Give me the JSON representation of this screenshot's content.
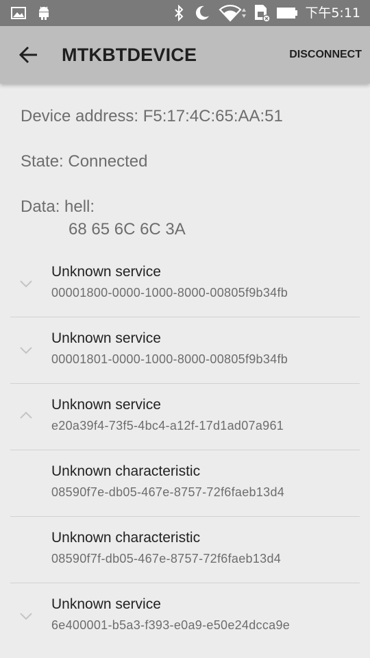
{
  "status_bar": {
    "time": "下午5:11",
    "icons": [
      "image-icon",
      "android-icon",
      "bluetooth-icon",
      "moon-icon",
      "wifi-icon",
      "sim-icon",
      "battery-icon"
    ]
  },
  "app_bar": {
    "title": "MTKBTDEVICE",
    "action": "DISCONNECT"
  },
  "device": {
    "address": "Device address: F5:17:4C:65:AA:51",
    "state": "State: Connected",
    "data_label": "Data: hell:",
    "data_hex": "68 65 6C 6C 3A"
  },
  "items": [
    {
      "title": "Unknown service",
      "uuid": "00001800-0000-1000-8000-00805f9b34fb",
      "chevron": "down"
    },
    {
      "title": "Unknown service",
      "uuid": "00001801-0000-1000-8000-00805f9b34fb",
      "chevron": "down"
    },
    {
      "title": "Unknown service",
      "uuid": "e20a39f4-73f5-4bc4-a12f-17d1ad07a961",
      "chevron": "up"
    },
    {
      "title": "Unknown characteristic",
      "uuid": "08590f7e-db05-467e-8757-72f6faeb13d4",
      "chevron": "none"
    },
    {
      "title": "Unknown characteristic",
      "uuid": "08590f7f-db05-467e-8757-72f6faeb13d4",
      "chevron": "none"
    },
    {
      "title": "Unknown service",
      "uuid": "6e400001-b5a3-f393-e0a9-e50e24dcca9e",
      "chevron": "down"
    }
  ],
  "colors": {
    "status_bar": "#7a7a7a",
    "app_bar": "#bdbdbd",
    "background": "#ececec",
    "divider": "#d2d2d2"
  }
}
